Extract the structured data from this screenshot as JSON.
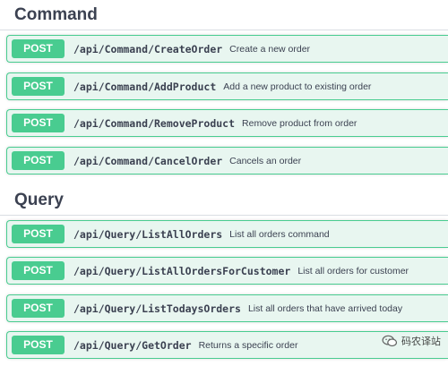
{
  "sections": [
    {
      "title": "Command",
      "operations": [
        {
          "method": "POST",
          "path": "/api/Command/CreateOrder",
          "description": "Create a new order"
        },
        {
          "method": "POST",
          "path": "/api/Command/AddProduct",
          "description": "Add a new product to existing order"
        },
        {
          "method": "POST",
          "path": "/api/Command/RemoveProduct",
          "description": "Remove product from order"
        },
        {
          "method": "POST",
          "path": "/api/Command/CancelOrder",
          "description": "Cancels an order"
        }
      ]
    },
    {
      "title": "Query",
      "operations": [
        {
          "method": "POST",
          "path": "/api/Query/ListAllOrders",
          "description": "List all orders command"
        },
        {
          "method": "POST",
          "path": "/api/Query/ListAllOrdersForCustomer",
          "description": "List all orders for customer"
        },
        {
          "method": "POST",
          "path": "/api/Query/ListTodaysOrders",
          "description": "List all orders that have arrived today"
        },
        {
          "method": "POST",
          "path": "/api/Query/GetOrder",
          "description": "Returns a specific order"
        }
      ]
    }
  ],
  "watermark": {
    "text": "码农译站",
    "icon": "wechat-icon"
  },
  "colors": {
    "post": "#49cc90",
    "post_bg": "#e8f6f0",
    "text": "#3b4151"
  }
}
